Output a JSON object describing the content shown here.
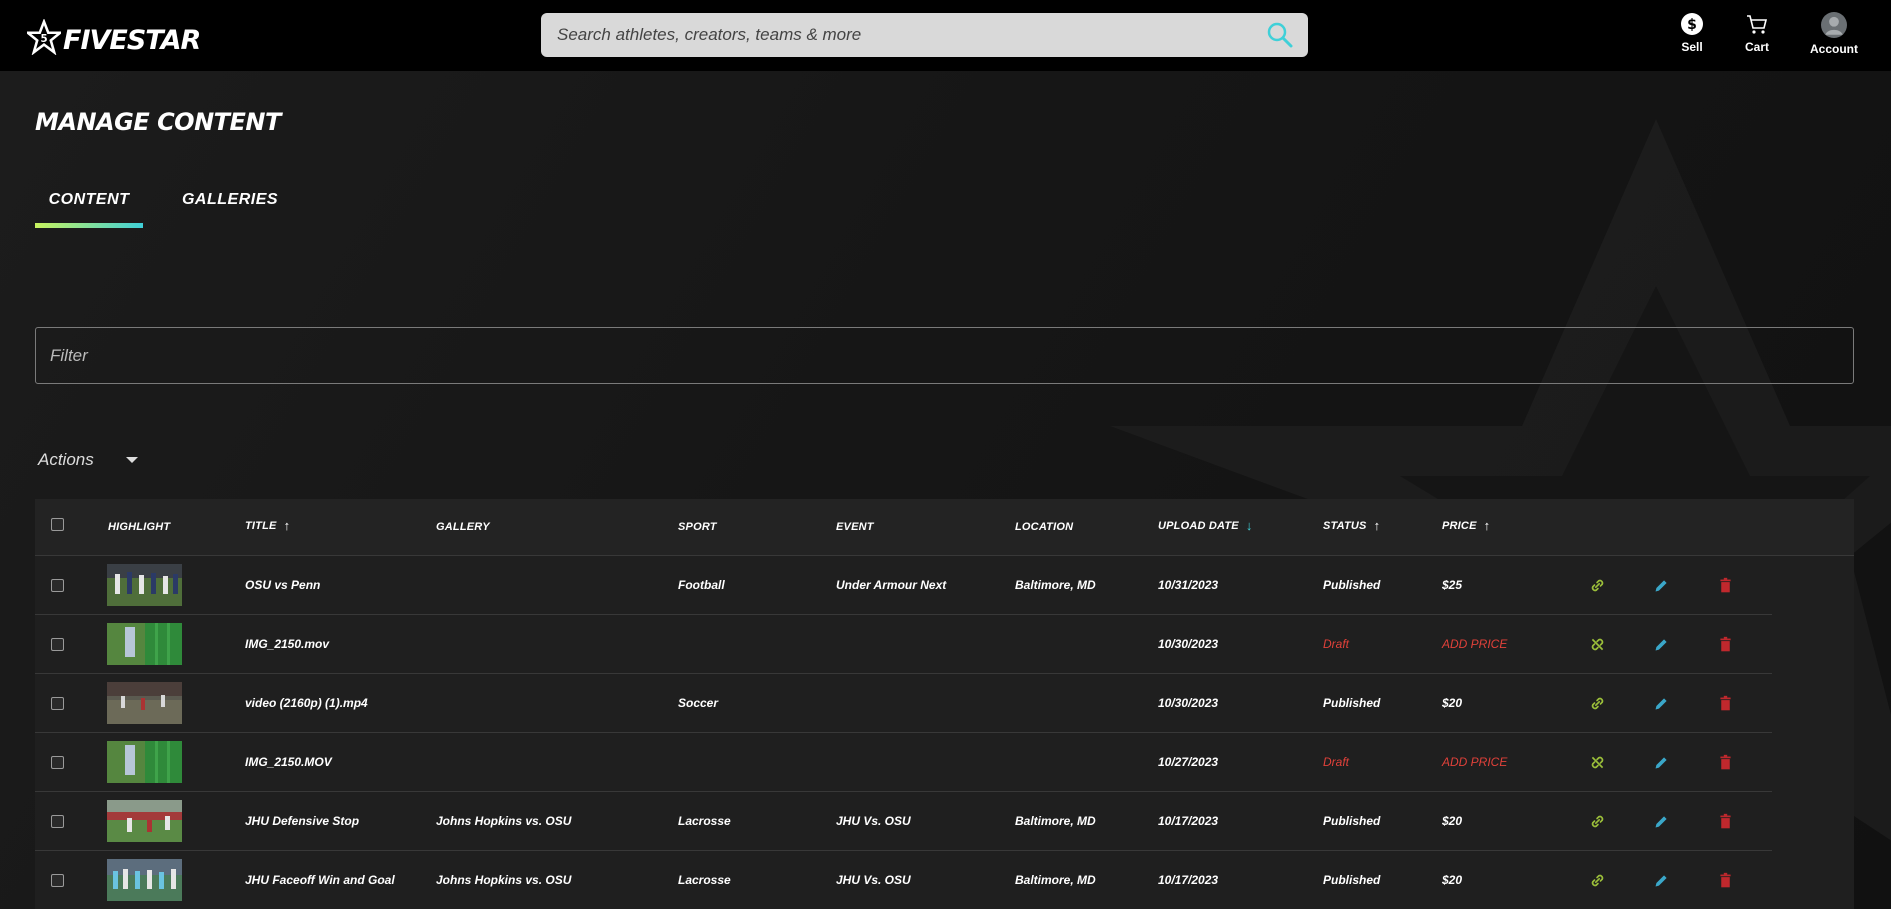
{
  "header": {
    "brand": "FIVESTAR",
    "search_placeholder": "Search athletes, creators, teams & more",
    "nav": [
      {
        "label": "Sell",
        "icon": "dollar-circle-icon"
      },
      {
        "label": "Cart",
        "icon": "cart-icon"
      },
      {
        "label": "Account",
        "icon": "avatar-icon"
      }
    ]
  },
  "page": {
    "title": "MANAGE CONTENT",
    "tabs": [
      {
        "label": "CONTENT",
        "active": true
      },
      {
        "label": "GALLERIES",
        "active": false
      }
    ],
    "filter_placeholder": "Filter",
    "actions_label": "Actions"
  },
  "table": {
    "columns": {
      "highlight": "HIGHLIGHT",
      "title": "TITLE",
      "gallery": "GALLERY",
      "sport": "SPORT",
      "event": "EVENT",
      "location": "LOCATION",
      "upload_date": "UPLOAD DATE",
      "status": "STATUS",
      "price": "PRICE"
    },
    "rows": [
      {
        "title": "OSU vs Penn",
        "gallery": "",
        "sport": "Football",
        "event": "Under Armour Next",
        "location": "Baltimore, MD",
        "date": "10/31/2023",
        "status": "Published",
        "price": "$25",
        "draft": false
      },
      {
        "title": "IMG_2150.mov",
        "gallery": "",
        "sport": "",
        "event": "",
        "location": "",
        "date": "10/30/2023",
        "status": "Draft",
        "price": "ADD PRICE",
        "draft": true
      },
      {
        "title": "video (2160p) (1).mp4",
        "gallery": "",
        "sport": "Soccer",
        "event": "",
        "location": "",
        "date": "10/30/2023",
        "status": "Published",
        "price": "$20",
        "draft": false
      },
      {
        "title": "IMG_2150.MOV",
        "gallery": "",
        "sport": "",
        "event": "",
        "location": "",
        "date": "10/27/2023",
        "status": "Draft",
        "price": "ADD PRICE",
        "draft": true
      },
      {
        "title": "JHU Defensive Stop",
        "gallery": "Johns Hopkins vs. OSU",
        "sport": "Lacrosse",
        "event": "JHU Vs. OSU",
        "location": "Baltimore, MD",
        "date": "10/17/2023",
        "status": "Published",
        "price": "$20",
        "draft": false
      },
      {
        "title": "JHU Faceoff Win and Goal",
        "gallery": "Johns Hopkins vs. OSU",
        "sport": "Lacrosse",
        "event": "JHU Vs. OSU",
        "location": "Baltimore, MD",
        "date": "10/17/2023",
        "status": "Published",
        "price": "$20",
        "draft": false
      }
    ]
  },
  "colors": {
    "accent_cyan": "#3fd0d8",
    "accent_lime": "#c8f25e",
    "link_green": "#9bbf3a",
    "edit_blue": "#3aa7c9",
    "delete_red": "#c0282d",
    "draft_red": "#e0413a"
  }
}
